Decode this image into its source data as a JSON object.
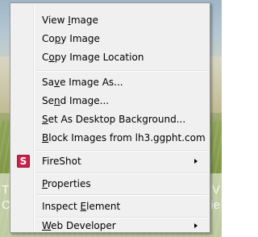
{
  "background": {
    "overlay_left": [
      "The",
      "Clic"
    ],
    "overlay_right": [
      "o V",
      "vie"
    ]
  },
  "menu": {
    "items": [
      {
        "label_pre": "View ",
        "label_key": "I",
        "label_post": "mage"
      },
      {
        "label_pre": "Co",
        "label_key": "p",
        "label_post": "y Image"
      },
      {
        "label_pre": "C",
        "label_key": "o",
        "label_post": "py Image Location"
      },
      {
        "label_pre": "Sa",
        "label_key": "v",
        "label_post": "e Image As..."
      },
      {
        "label_pre": "Se",
        "label_key": "n",
        "label_post": "d Image..."
      },
      {
        "label_pre": "",
        "label_key": "S",
        "label_post": "et As Desktop Background..."
      },
      {
        "label_pre": "",
        "label_key": "B",
        "label_post": "lock Images from lh3.ggpht.com"
      },
      {
        "label_pre": "FireShot",
        "label_key": "",
        "label_post": "",
        "icon": "fireshot-icon",
        "icon_glyph": "S",
        "submenu": true
      },
      {
        "label_pre": "",
        "label_key": "P",
        "label_post": "roperties"
      },
      {
        "label_pre": "Inspect ",
        "label_key": "E",
        "label_post": "lement"
      },
      {
        "label_pre": "",
        "label_key": "W",
        "label_post": "eb Developer",
        "submenu": true
      }
    ]
  },
  "colors": {
    "menu_bg": "#f0f0f0",
    "menu_border": "#979797",
    "fireshot_icon": "#c8234a"
  }
}
